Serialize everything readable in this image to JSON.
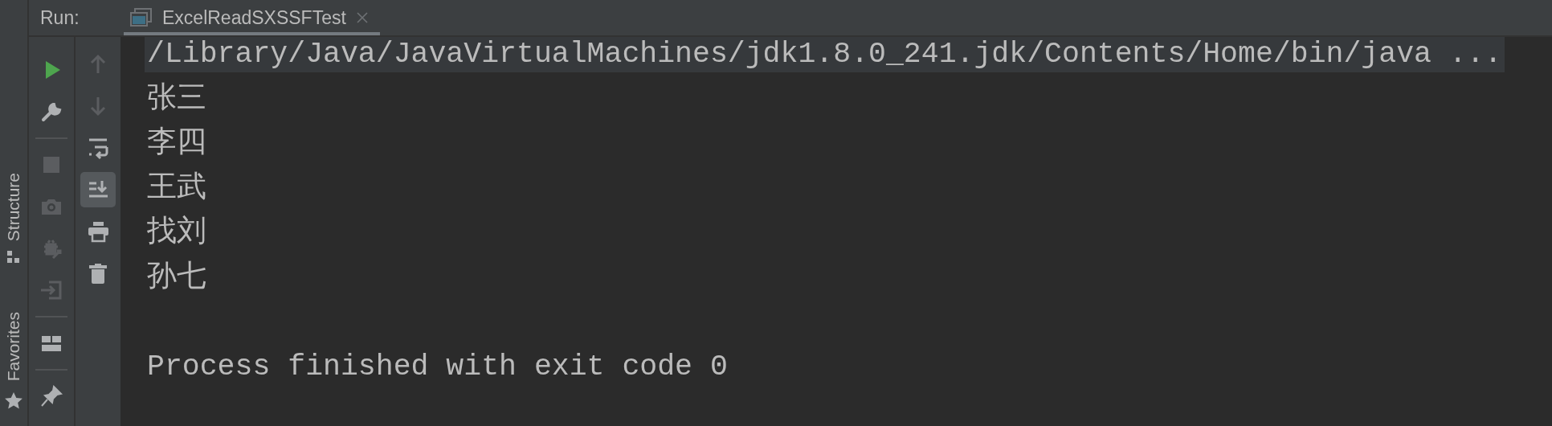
{
  "sidebar": {
    "tabs": [
      {
        "label": "Structure",
        "kind": "structure"
      },
      {
        "label": "Favorites",
        "kind": "favorites"
      }
    ]
  },
  "header": {
    "label": "Run:",
    "tab": {
      "title": "ExcelReadSXSSFTest",
      "selected": true
    }
  },
  "left_toolbar": [
    {
      "kind": "run",
      "disabled": false
    },
    {
      "kind": "wrench",
      "disabled": false
    },
    {
      "kind": "divider"
    },
    {
      "kind": "stop",
      "disabled": true
    },
    {
      "kind": "camera",
      "disabled": true
    },
    {
      "kind": "debug",
      "disabled": true
    },
    {
      "kind": "login",
      "disabled": true
    },
    {
      "kind": "divider"
    },
    {
      "kind": "layout",
      "disabled": false
    },
    {
      "kind": "divider"
    },
    {
      "kind": "pin",
      "disabled": false
    }
  ],
  "right_toolbar": [
    {
      "kind": "up",
      "disabled": true,
      "selected": false
    },
    {
      "kind": "down",
      "disabled": true,
      "selected": false
    },
    {
      "kind": "wrap",
      "disabled": false,
      "selected": false
    },
    {
      "kind": "scroll",
      "disabled": false,
      "selected": true
    },
    {
      "kind": "print",
      "disabled": false,
      "selected": false
    },
    {
      "kind": "trash",
      "disabled": false,
      "selected": false
    }
  ],
  "console": {
    "lines": [
      {
        "kind": "text",
        "text": "/Library/Java/JavaVirtualMachines/jdk1.8.0_241.jdk/Contents/Home/bin/java ...",
        "highlighted": true
      },
      {
        "kind": "text",
        "text": "张三",
        "highlighted": false
      },
      {
        "kind": "text",
        "text": "李四",
        "highlighted": false
      },
      {
        "kind": "text",
        "text": "王武",
        "highlighted": false
      },
      {
        "kind": "text",
        "text": "找刘",
        "highlighted": false
      },
      {
        "kind": "text",
        "text": "孙七",
        "highlighted": false
      },
      {
        "kind": "blank"
      },
      {
        "kind": "text",
        "text": "Process finished with exit code 0",
        "highlighted": false
      }
    ]
  }
}
